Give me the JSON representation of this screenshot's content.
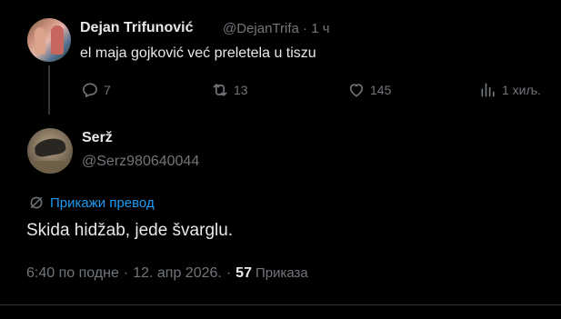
{
  "parent_tweet": {
    "author_name": "Dejan Trifunović",
    "handle": "@DejanTrifa",
    "separator": "·",
    "time": "1 ч",
    "text": "el maja gojković već preletela u tiszu",
    "actions": {
      "reply_count": "7",
      "retweet_count": "13",
      "like_count": "145",
      "views_count": "1 хиљ."
    }
  },
  "reply": {
    "author_name": "Serž",
    "handle": "@Serz980640044",
    "translate_label": "Прикажи превод",
    "text": "Skida hidžab, jede švarglu.",
    "time": "6:40 по подне",
    "date": "12. апр 2026.",
    "separator": "·",
    "views_count": "57",
    "views_label": "Приказа"
  },
  "colors": {
    "background": "#000000",
    "text_primary": "#e7e9ea",
    "text_muted": "#71767b",
    "link": "#1d9bf0",
    "divider": "#2f3336"
  },
  "icons": [
    "reply-icon",
    "retweet-icon",
    "like-icon",
    "views-icon",
    "translate-icon"
  ]
}
